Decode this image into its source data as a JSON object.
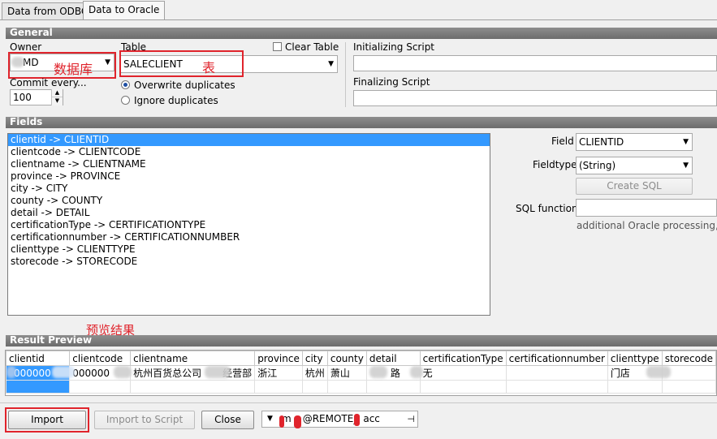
{
  "tabs": [
    {
      "label": "Data from ODBC",
      "active": false
    },
    {
      "label": "Data to Oracle",
      "active": true
    }
  ],
  "general": {
    "header": "General",
    "owner_label": "Owner",
    "owner_value": "MD",
    "owner_annotation": "数据库",
    "table_label": "Table",
    "table_value": "SALECLIENT",
    "table_annotation": "表",
    "clear_table_label": "Clear Table",
    "commit_label": "Commit every...",
    "commit_value": "100",
    "overwrite_label": "Overwrite duplicates",
    "ignore_label": "Ignore duplicates",
    "init_script_label": "Initializing Script",
    "final_script_label": "Finalizing Script"
  },
  "fields": {
    "header": "Fields",
    "items": [
      "clientid  ->  CLIENTID",
      "clientcode  ->  CLIENTCODE",
      "clientname  ->  CLIENTNAME",
      "province  ->  PROVINCE",
      "city  ->  CITY",
      "county  ->  COUNTY",
      "detail  ->  DETAIL",
      "certificationType  ->  CERTIFICATIONTYPE",
      "certificationnumber  ->  CERTIFICATIONNUMBER",
      "clienttype  ->  CLIENTTYPE",
      "storecode  ->  STORECODE"
    ],
    "field_label": "Field",
    "field_value": "CLIENTID",
    "fieldtype_label": "Fieldtype",
    "fieldtype_value": "(String)",
    "create_sql_label": "Create SQL",
    "sql_function_label": "SQL function",
    "sql_hint": "additional Oracle processing, for"
  },
  "preview": {
    "annotation": "预览结果",
    "header": "Result Preview",
    "columns": [
      "clientid",
      "clientcode",
      "clientname",
      "province",
      "city",
      "county",
      "detail",
      "certificationType",
      "certificationnumber",
      "clienttype",
      "storecode"
    ],
    "row": [
      "000000",
      "000000",
      "杭州百货总公司",
      "浙江",
      "杭州",
      "萧山",
      "",
      "无",
      "",
      "门店",
      ""
    ],
    "row_clientname_suffix": "经营部",
    "row_detail_suffix": "路"
  },
  "footer": {
    "import_label": "Import",
    "import_script_label": "Import to Script",
    "close_label": "Close",
    "connection_prefix": "m",
    "connection_value": "@REMOTE_",
    "connection_suffix": "acc"
  },
  "colors": {
    "selection": "#3399ff",
    "annotation_red": "#e0242c",
    "section_header": "#7a7a7a"
  }
}
